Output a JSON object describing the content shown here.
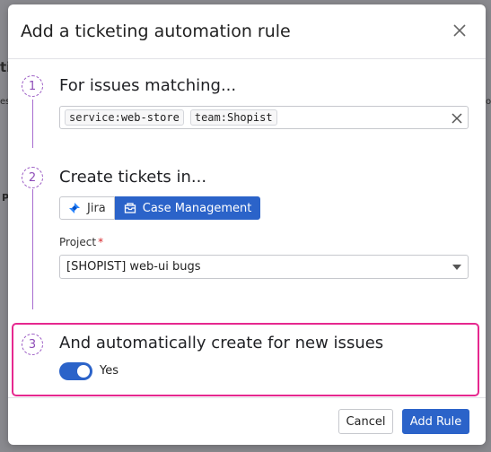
{
  "modal": {
    "title": "Add a ticketing automation rule"
  },
  "steps": [
    {
      "number": "1",
      "heading": "For issues matching..."
    },
    {
      "number": "2",
      "heading": "Create tickets in..."
    },
    {
      "number": "3",
      "heading": "And automatically create for new issues"
    }
  ],
  "filter": {
    "tags": [
      {
        "key": "service",
        "sep": ":",
        "value": "web-store"
      },
      {
        "key": "team",
        "sep": ":",
        "value": "Shopist"
      }
    ]
  },
  "destination": {
    "options": [
      {
        "label": "Jira",
        "icon": "jira-icon",
        "selected": false
      },
      {
        "label": "Case Management",
        "icon": "case-management-icon",
        "selected": true
      }
    ]
  },
  "project": {
    "label": "Project",
    "required_mark": "*",
    "value": "[SHOPIST] web-ui bugs"
  },
  "auto_create": {
    "enabled": true,
    "label": "Yes"
  },
  "footer": {
    "cancel_label": "Cancel",
    "add_label": "Add Rule"
  },
  "colors": {
    "primary": "#2b63c9",
    "highlight": "#e6288f",
    "step_accent": "#9b5bc4",
    "required": "#d6262b"
  },
  "background": {
    "fragment_texts": [
      "ti",
      "es",
      "P",
      "ol"
    ]
  }
}
